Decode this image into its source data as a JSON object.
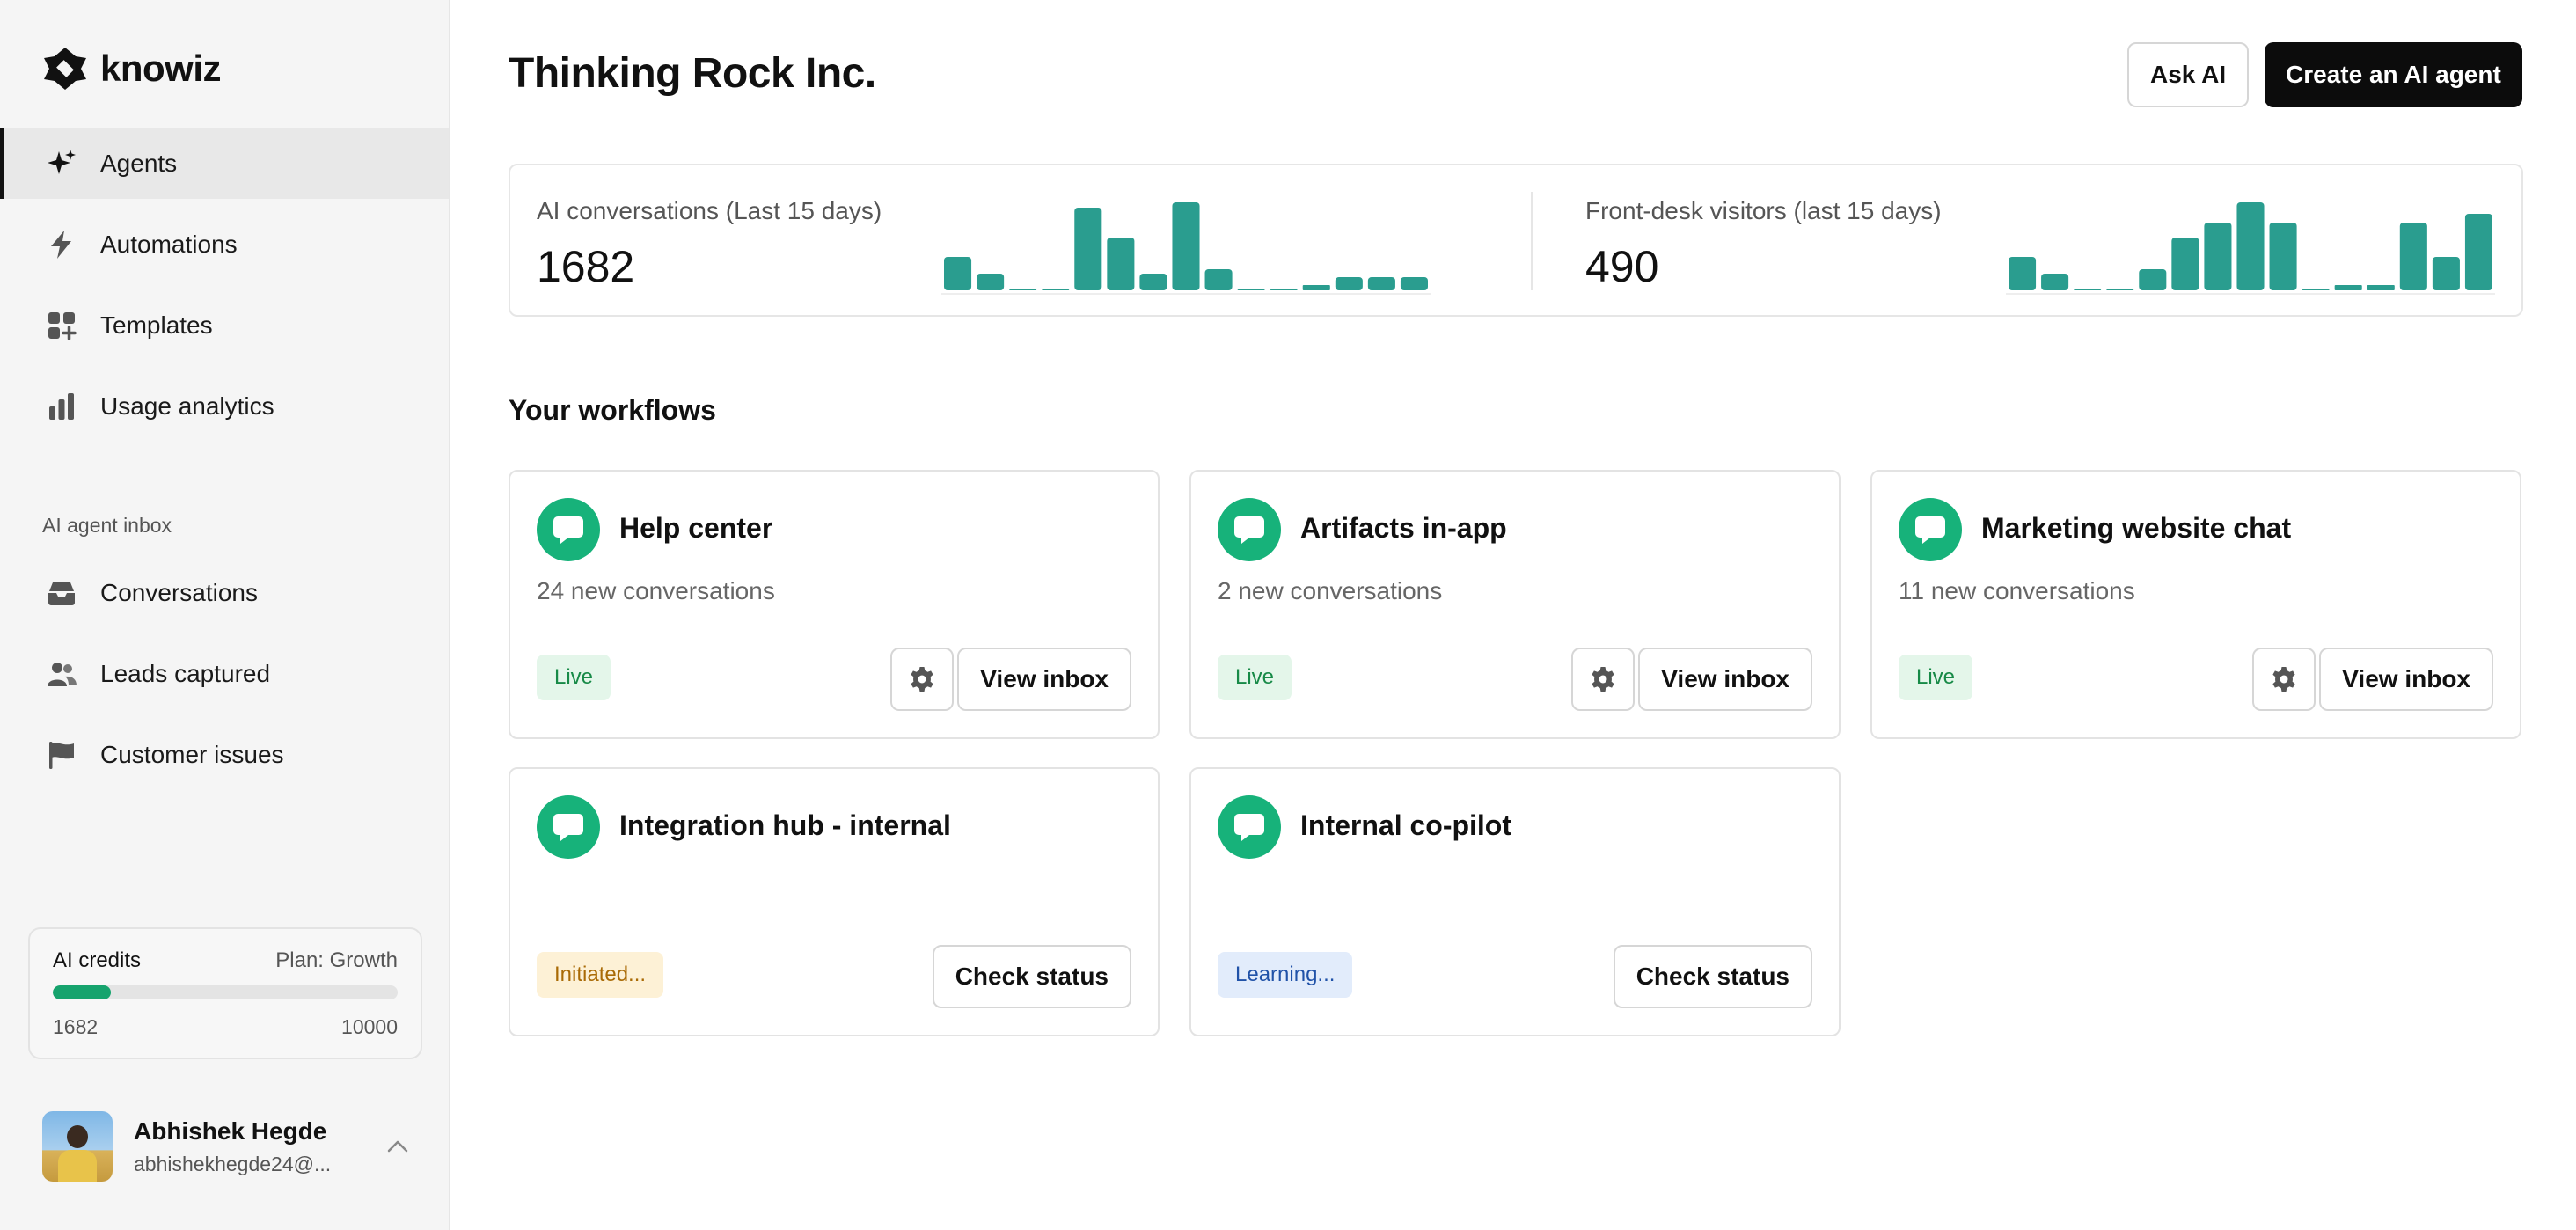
{
  "brand": {
    "name": "knowiz"
  },
  "sidebar": {
    "nav": [
      {
        "label": "Agents",
        "icon": "sparkles-icon",
        "active": true
      },
      {
        "label": "Automations",
        "icon": "lightning-icon"
      },
      {
        "label": "Templates",
        "icon": "templates-grid-icon"
      },
      {
        "label": "Usage analytics",
        "icon": "bar-chart-icon"
      }
    ],
    "inbox_section": "AI agent inbox",
    "inbox": [
      {
        "label": "Conversations",
        "icon": "inbox-tray-icon"
      },
      {
        "label": "Leads captured",
        "icon": "users-icon"
      },
      {
        "label": "Customer issues",
        "icon": "flag-icon"
      }
    ],
    "credits": {
      "title": "AI credits",
      "plan": "Plan: Growth",
      "used": "1682",
      "total": "10000",
      "fraction": 0.1682
    },
    "user": {
      "name": "Abhishek Hegde",
      "email": "abhishekhegde24@..."
    }
  },
  "header": {
    "title": "Thinking Rock Inc.",
    "ask_ai": "Ask AI",
    "create_agent": "Create an AI agent"
  },
  "stats": [
    {
      "label": "AI conversations (Last 15 days)",
      "value": "1682",
      "bars": [
        0.38,
        0.19,
        0.02,
        0.02,
        0.94,
        0.6,
        0.19,
        1.0,
        0.24,
        0.02,
        0.02,
        0.06,
        0.15,
        0.15,
        0.15
      ]
    },
    {
      "label": "Front-desk visitors (last 15 days)",
      "value": "490",
      "bars": [
        0.38,
        0.19,
        0.02,
        0.02,
        0.24,
        0.6,
        0.77,
        1.0,
        0.77,
        0.02,
        0.06,
        0.06,
        0.77,
        0.38,
        0.87
      ]
    }
  ],
  "colors": {
    "accent": "#2a9d8f",
    "brand_green": "#17b27a",
    "progress": "#16a36d"
  },
  "workflows": {
    "title": "Your workflows",
    "cards": [
      {
        "title": "Help center",
        "subtitle": "24 new conversations",
        "status": "Live",
        "status_kind": "live",
        "action": "View inbox",
        "settings": true
      },
      {
        "title": "Artifacts in-app",
        "subtitle": "2 new conversations",
        "status": "Live",
        "status_kind": "live",
        "action": "View inbox",
        "settings": true
      },
      {
        "title": "Marketing website chat",
        "subtitle": "11 new conversations",
        "status": "Live",
        "status_kind": "live",
        "action": "View inbox",
        "settings": true
      },
      {
        "title": "Integration hub - internal",
        "subtitle": "",
        "status": "Initiated...",
        "status_kind": "init",
        "action": "Check status",
        "settings": false
      },
      {
        "title": "Internal co-pilot",
        "subtitle": "",
        "status": "Learning...",
        "status_kind": "learn",
        "action": "Check status",
        "settings": false
      }
    ]
  }
}
